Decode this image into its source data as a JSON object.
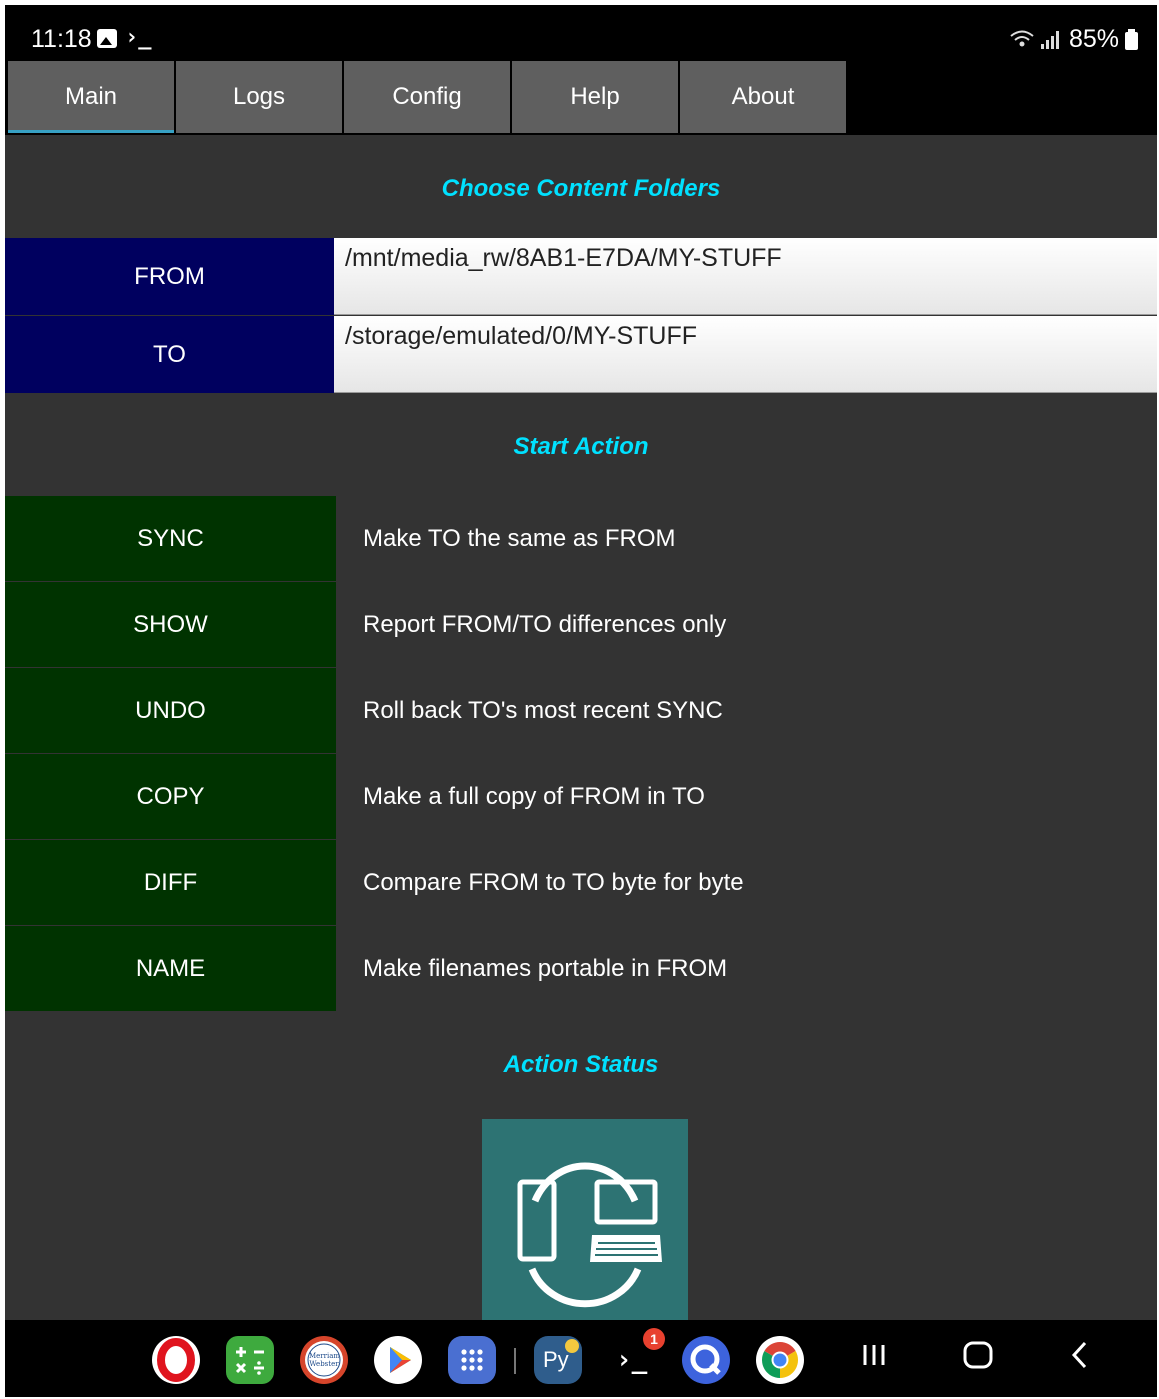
{
  "status_bar": {
    "time": "11:18",
    "terminal_glyph": "›_",
    "battery": "85%",
    "icons": [
      "gallery-icon",
      "terminal-icon",
      "wifi-icon",
      "signal-icon",
      "battery-icon"
    ]
  },
  "tabs": [
    {
      "label": "Main",
      "active": true
    },
    {
      "label": "Logs",
      "active": false
    },
    {
      "label": "Config",
      "active": false
    },
    {
      "label": "Help",
      "active": false
    },
    {
      "label": "About",
      "active": false
    }
  ],
  "folders": {
    "title": "Choose Content Folders",
    "from_label": "FROM",
    "from_path": "/mnt/media_rw/8AB1-E7DA/MY-STUFF",
    "to_label": "TO",
    "to_path": "/storage/emulated/0/MY-STUFF"
  },
  "actions": {
    "title": "Start Action",
    "items": [
      {
        "label": "SYNC",
        "description": "Make TO the same as FROM"
      },
      {
        "label": "SHOW",
        "description": "Report FROM/TO differences only"
      },
      {
        "label": "UNDO",
        "description": "Roll back TO's most recent SYNC"
      },
      {
        "label": "COPY",
        "description": "Make a full copy of FROM in TO"
      },
      {
        "label": "DIFF",
        "description": "Compare FROM to TO byte for byte"
      },
      {
        "label": "NAME",
        "description": "Make filenames portable in FROM"
      }
    ]
  },
  "status": {
    "title": "Action Status",
    "image": "sync-devices-icon"
  },
  "dock": {
    "apps": [
      "opera-icon",
      "calculator-icon",
      "merriam-webster-icon",
      "play-store-icon",
      "app-drawer-icon",
      "pydroid-icon",
      "termux-icon",
      "qtranslate-icon",
      "chrome-icon"
    ],
    "merriam_webster_text": "Merriam-Webster",
    "pydroid_text": "Py",
    "terminal_text": "›_",
    "notification_badge": "1"
  },
  "nav": [
    "recents-icon",
    "home-icon",
    "back-icon"
  ],
  "colors": {
    "content_bg": "#333333",
    "title_accent": "#00e1ff",
    "folder_label_bg": "#00005f",
    "action_btn_bg": "#003300",
    "tab_bg": "#5f5f5f",
    "tab_indicator": "#37a1c4",
    "status_image_bg": "#2d7373"
  }
}
